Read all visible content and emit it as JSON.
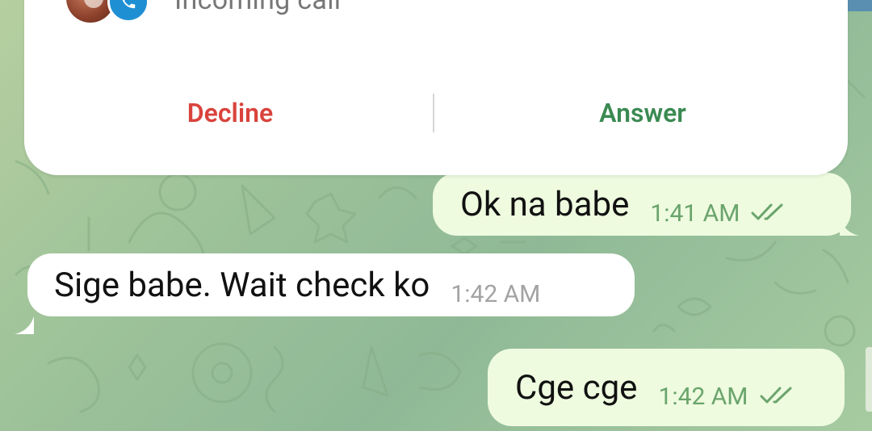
{
  "call": {
    "status": "Incoming call",
    "decline_label": "Decline",
    "answer_label": "Answer"
  },
  "messages": [
    {
      "direction": "outgoing",
      "text": "Ok na babe",
      "time": "1:41 AM",
      "read": true
    },
    {
      "direction": "incoming",
      "text": "Sige babe. Wait check ko",
      "time": "1:42 AM"
    },
    {
      "direction": "outgoing",
      "text": "Cge cge",
      "time": "1:42 AM",
      "read": true
    }
  ],
  "colors": {
    "decline": "#d9433c",
    "answer": "#3a8a52",
    "outgoing_bubble": "#eefbdf",
    "incoming_bubble": "#ffffff",
    "call_badge": "#1f8fd3",
    "chat_background": "#9fc39a"
  },
  "icons": {
    "call_badge": "phone-icon",
    "read_receipt": "double-check-icon"
  }
}
